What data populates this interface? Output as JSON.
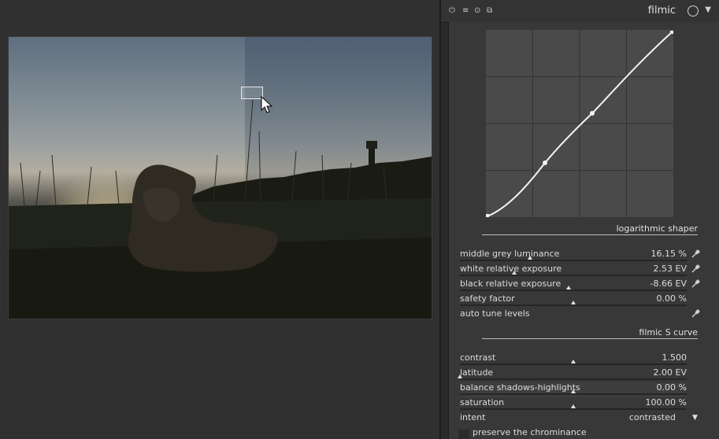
{
  "module": {
    "title": "filmic",
    "icons": [
      "power-icon",
      "multi-instance-icon",
      "reset-icon",
      "copy-icon",
      "presets-icon",
      "collapse-icon"
    ]
  },
  "sections": {
    "shaper": "logarithmic shaper",
    "scurve": "filmic S curve"
  },
  "params": [
    {
      "label": "middle grey luminance",
      "value": "16.15 %",
      "level": 0.31,
      "picker": true
    },
    {
      "label": "white relative exposure",
      "value": "2.53 EV",
      "level": 0.24,
      "picker": true
    },
    {
      "label": "black relative exposure",
      "value": "-8.66 EV",
      "level": 0.48,
      "picker": true
    },
    {
      "label": "safety factor",
      "value": "0.00 %",
      "level": 0.5,
      "picker": false
    },
    {
      "label": "auto tune levels",
      "value": "",
      "level": null,
      "picker": true
    }
  ],
  "curve_params": [
    {
      "label": "contrast",
      "value": "1.500",
      "level": 0.5
    },
    {
      "label": "latitude",
      "value": "2.00 EV",
      "level": 0.0
    },
    {
      "label": "balance shadows-highlights",
      "value": "0.00 %",
      "level": 0.5
    },
    {
      "label": "saturation",
      "value": "100.00 %",
      "level": 0.5
    },
    {
      "label": "intent",
      "value": "contrasted",
      "level": null
    }
  ],
  "checkbox": {
    "label": "preserve the chrominance",
    "checked": false
  },
  "colors": {
    "accent": "#e0e0e0",
    "panel_bg": "#383838",
    "header_bg": "#333333"
  }
}
